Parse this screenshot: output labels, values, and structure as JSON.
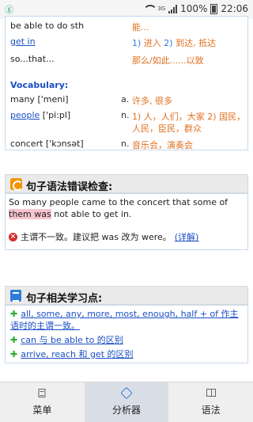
{
  "status": {
    "app_glyph": "ⓖ",
    "network": "3G",
    "battery": "100%",
    "time": "22:06"
  },
  "vocab_top": [
    {
      "en": "be able to do sth",
      "cn": "能..."
    },
    {
      "en": "get in",
      "cn_nums": [
        "1)",
        "2)"
      ],
      "cn_parts": [
        "进入",
        "到达, 抵达"
      ],
      "link": true
    },
    {
      "en": "so...that...",
      "cn": "那么/如此......以致"
    }
  ],
  "vocabulary": {
    "heading": "Vocabulary:",
    "items": [
      {
        "word": "many",
        "phon": "['meni]",
        "pos": "a.",
        "cn": "许多, 很多",
        "link": false
      },
      {
        "word": "people",
        "phon": "['pi:pl]",
        "pos": "n.",
        "cn1": "1) 人，人们，大家",
        "cn2": "2) 国民，",
        "cn3": "人民，臣民，群众",
        "link": true
      },
      {
        "word": "concert",
        "phon": "['kɔnsət]",
        "pos": "n.",
        "cn": "音乐会，演奏会",
        "link": false
      }
    ]
  },
  "grammar_check": {
    "title": "句子语法错误检查:",
    "sentence_pre": "So many people came to the concert that some of ",
    "sentence_hl": "them was",
    "sentence_post": " not able to get in.",
    "error_text": "主谓不一致。建议把 was 改为 were。",
    "detail_link": "(详解)"
  },
  "learning_points": {
    "title": "句子相关学习点:",
    "items": [
      "all, some, any, more, most, enough, half + of 作主语时的主谓一致。",
      "can 与 be able to 的区别",
      "arrive, reach 和 get 的区别"
    ]
  },
  "nav": {
    "tabs": [
      "菜单",
      "分析器",
      "语法"
    ],
    "active_index": 1
  }
}
